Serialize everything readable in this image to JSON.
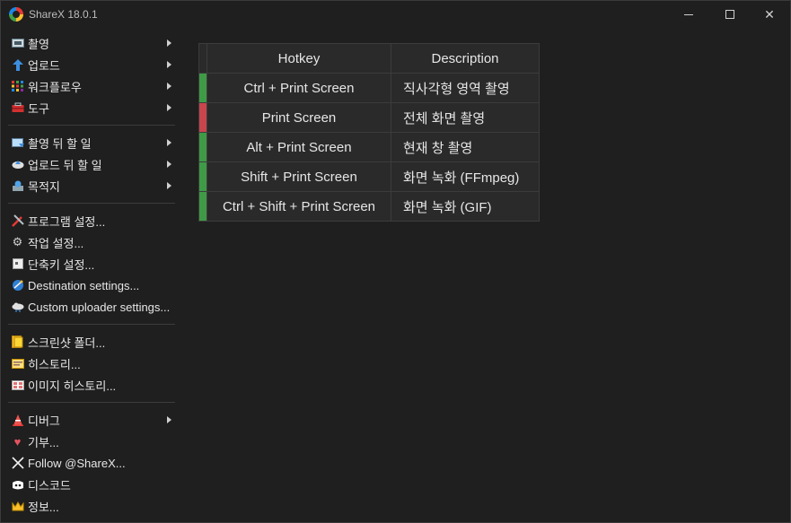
{
  "window": {
    "title": "ShareX 18.0.1",
    "controls": {
      "minimize": "minimize",
      "maximize": "maximize",
      "close": "✕"
    }
  },
  "menu": {
    "group1": [
      {
        "label": "촬영",
        "icon": "capture-icon",
        "submenu": true
      },
      {
        "label": "업로드",
        "icon": "upload-arrow-icon",
        "submenu": true
      },
      {
        "label": "워크플로우",
        "icon": "workflow-icon",
        "submenu": true
      },
      {
        "label": "도구",
        "icon": "toolbox-icon",
        "submenu": true
      }
    ],
    "group2": [
      {
        "label": "촬영 뒤 할 일",
        "icon": "after-capture-icon",
        "submenu": true
      },
      {
        "label": "업로드 뒤 할 일",
        "icon": "after-upload-icon",
        "submenu": true
      },
      {
        "label": "목적지",
        "icon": "destination-icon",
        "submenu": true
      }
    ],
    "group3": [
      {
        "label": "프로그램 설정...",
        "icon": "tools-icon"
      },
      {
        "label": "작업 설정...",
        "icon": "gear-icon"
      },
      {
        "label": "단축키 설정...",
        "icon": "keyboard-icon"
      },
      {
        "label": "Destination settings...",
        "icon": "globe-icon"
      },
      {
        "label": "Custom uploader settings...",
        "icon": "cloud-icon"
      }
    ],
    "group4": [
      {
        "label": "스크린샷 폴더...",
        "icon": "folder-icon"
      },
      {
        "label": "히스토리...",
        "icon": "history-icon"
      },
      {
        "label": "이미지 히스토리...",
        "icon": "image-history-icon"
      }
    ],
    "group5": [
      {
        "label": "디버그",
        "icon": "traffic-cone-icon",
        "submenu": true
      },
      {
        "label": "기부...",
        "icon": "heart-icon"
      },
      {
        "label": "Follow @ShareX...",
        "icon": "x-logo-icon"
      },
      {
        "label": "디스코드",
        "icon": "discord-icon"
      },
      {
        "label": "정보...",
        "icon": "crown-icon"
      }
    ]
  },
  "hotkeys": {
    "headers": {
      "hotkey": "Hotkey",
      "description": "Description"
    },
    "rows": [
      {
        "hotkey": "Ctrl + Print Screen",
        "description": "직사각형 영역 촬영",
        "status": "ok"
      },
      {
        "hotkey": "Print Screen",
        "description": "전체 화면 촬영",
        "status": "fail"
      },
      {
        "hotkey": "Alt + Print Screen",
        "description": "현재 창 촬영",
        "status": "ok"
      },
      {
        "hotkey": "Shift + Print Screen",
        "description": "화면 녹화 (FFmpeg)",
        "status": "ok"
      },
      {
        "hotkey": "Ctrl + Shift + Print Screen",
        "description": "화면 녹화 (GIF)",
        "status": "ok"
      }
    ],
    "colors": {
      "ok": "#3f9a47",
      "fail": "#c9454d"
    }
  }
}
